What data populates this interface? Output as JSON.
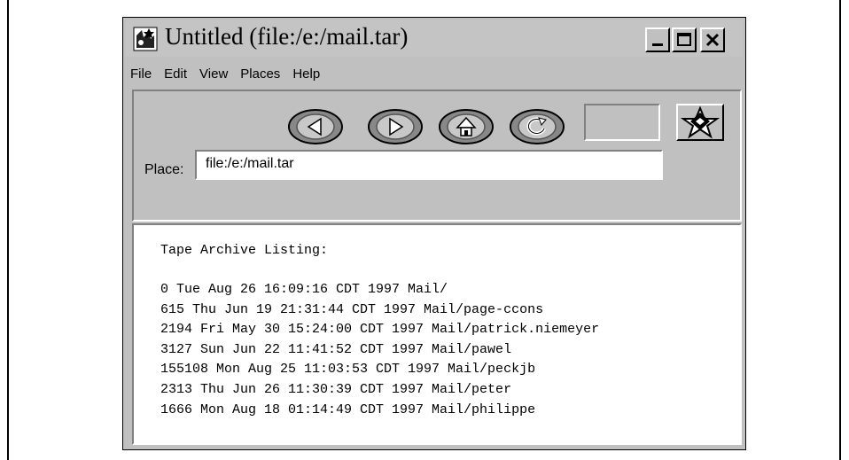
{
  "window": {
    "title": "Untitled (file:/e:/mail.tar)",
    "icon": "netscape-app-icon",
    "controls": [
      "minimize-icon",
      "maximize-icon",
      "close-icon"
    ]
  },
  "menu": [
    "File",
    "Edit",
    "View",
    "Places",
    "Help"
  ],
  "toolbar": {
    "buttons": [
      "back-arrow-icon",
      "forward-arrow-icon",
      "home-icon",
      "reload-icon"
    ],
    "logo": "star-logo-icon"
  },
  "place": {
    "label": "Place:",
    "value": "file:/e:/mail.tar"
  },
  "content": {
    "heading": "Tape Archive Listing:",
    "entries": [
      "0 Tue Aug 26 16:09:16 CDT 1997 Mail/",
      "615 Thu Jun 19 21:31:44 CDT 1997 Mail/page-ccons",
      "2194 Fri May 30 15:24:00 CDT 1997 Mail/patrick.niemeyer",
      "3127 Sun Jun 22 11:41:52 CDT 1997 Mail/pawel",
      "155108 Mon Aug 25 11:03:53 CDT 1997 Mail/peckjb",
      "2313 Thu Jun 26 11:30:39 CDT 1997 Mail/peter",
      "1666 Mon Aug 18 01:14:49 CDT 1997 Mail/philippe"
    ]
  }
}
